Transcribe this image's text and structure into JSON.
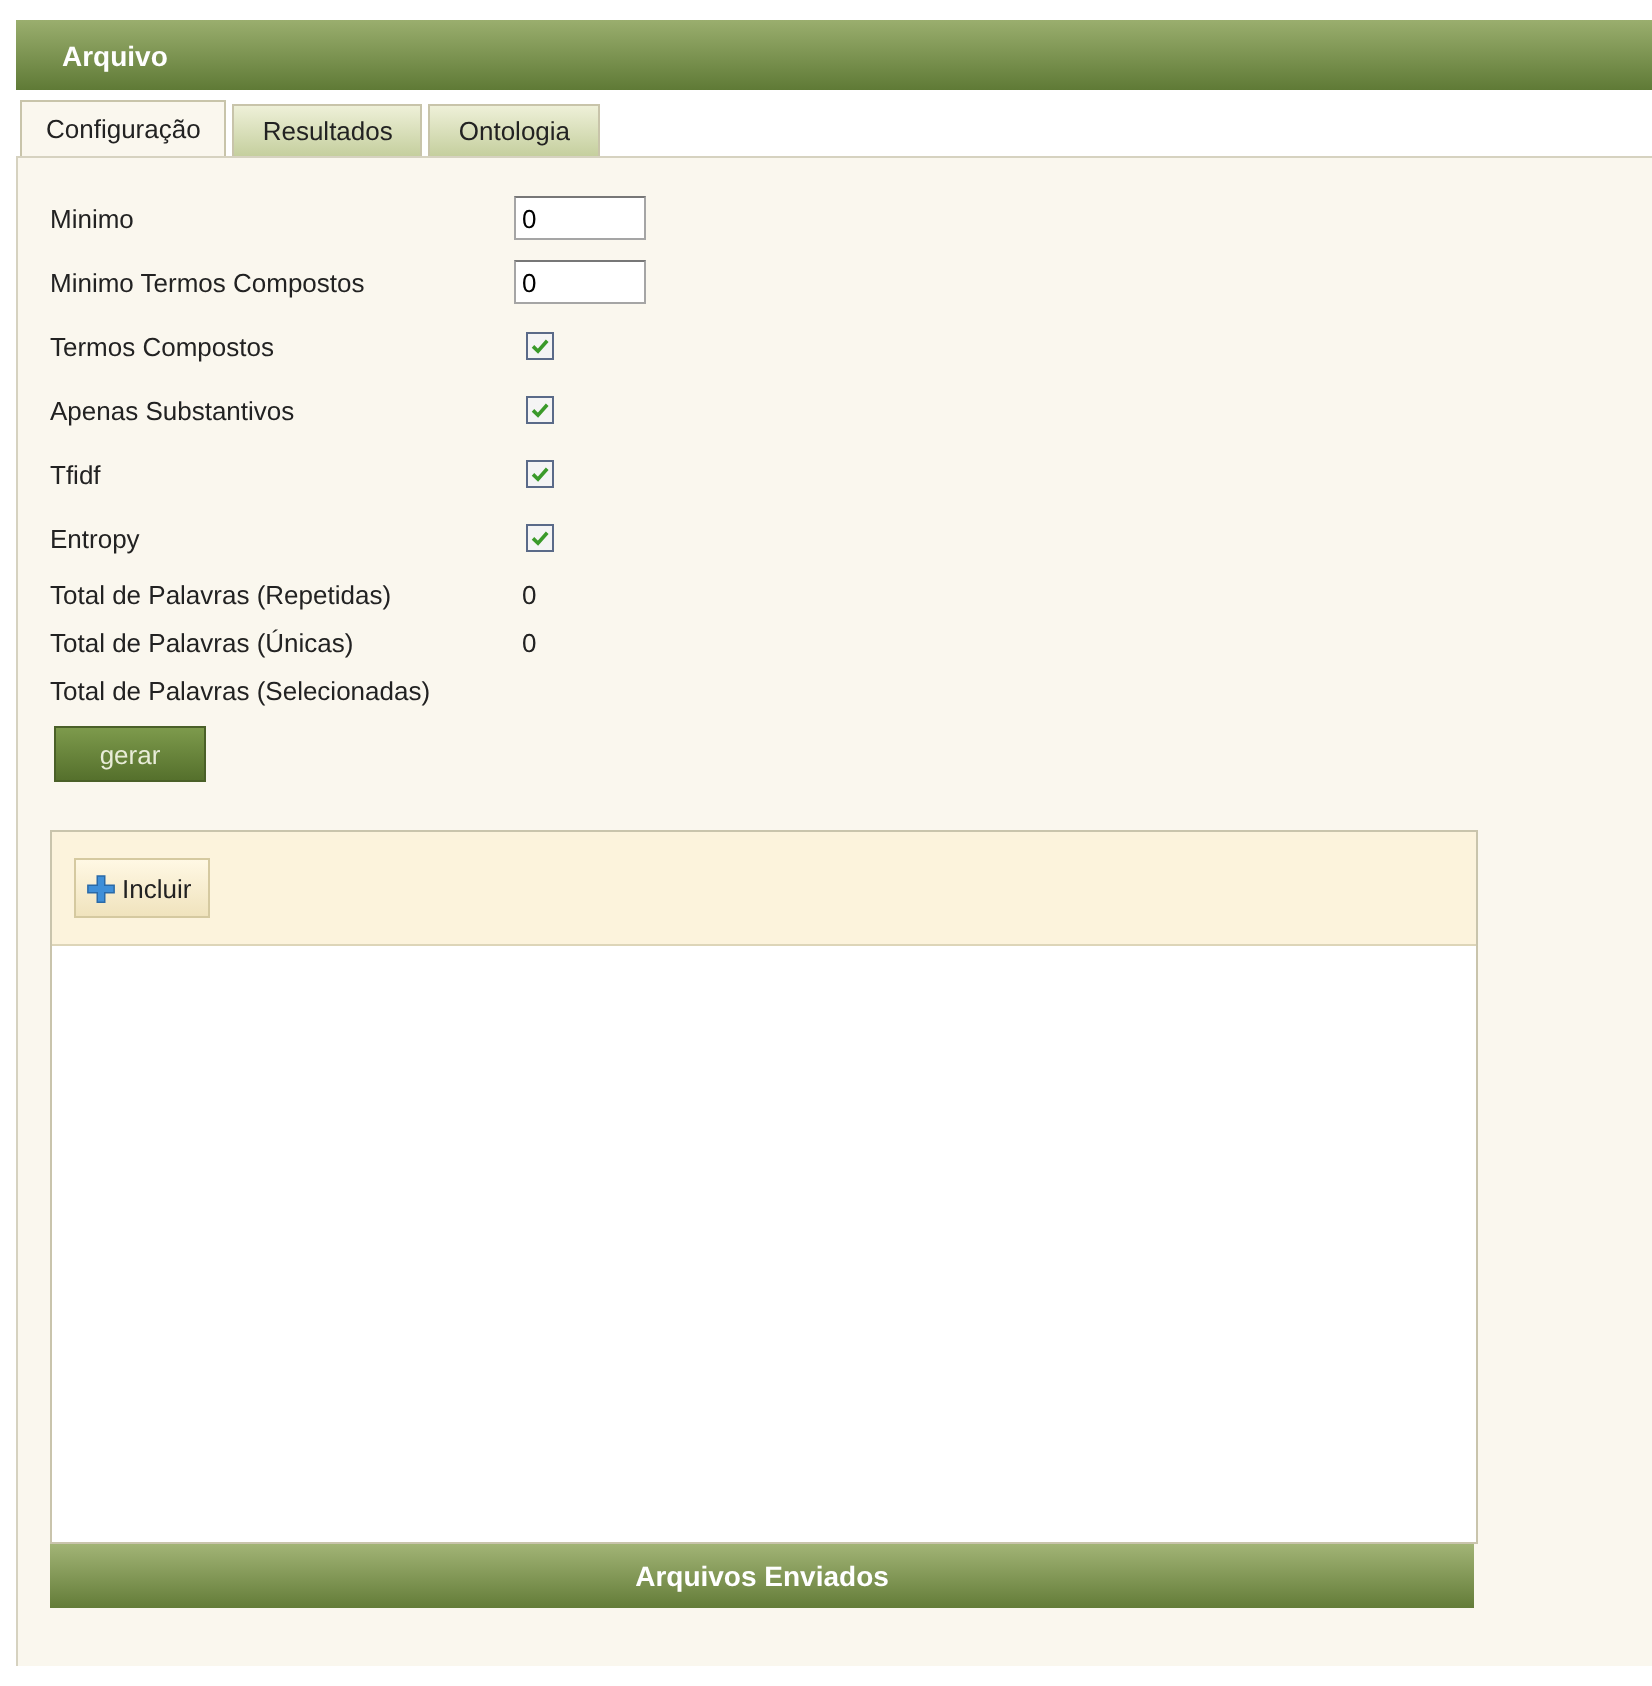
{
  "header": {
    "title": "Arquivo"
  },
  "tabs": [
    {
      "label": "Configuração",
      "selected": true
    },
    {
      "label": "Resultados",
      "selected": false
    },
    {
      "label": "Ontologia",
      "selected": false
    }
  ],
  "fields": [
    {
      "kind": "input",
      "label": "Minimo",
      "value": "0"
    },
    {
      "kind": "input",
      "label": "Minimo Termos Compostos",
      "value": "0"
    },
    {
      "kind": "checkbox",
      "label": "Termos Compostos",
      "checked": true
    },
    {
      "kind": "checkbox",
      "label": "Apenas Substantivos",
      "checked": true
    },
    {
      "kind": "checkbox",
      "label": "Tfidf",
      "checked": true
    },
    {
      "kind": "checkbox",
      "label": "Entropy",
      "checked": true
    },
    {
      "kind": "value",
      "label": "Total de Palavras (Repetidas)",
      "value": "0"
    },
    {
      "kind": "value",
      "label": "Total de Palavras (Únicas)",
      "value": "0"
    },
    {
      "kind": "value",
      "label": "Total de Palavras (Selecionadas)"
    }
  ],
  "generate_button": "gerar",
  "files_panel": {
    "add_button": "Incluir",
    "footer": "Arquivos Enviados"
  }
}
